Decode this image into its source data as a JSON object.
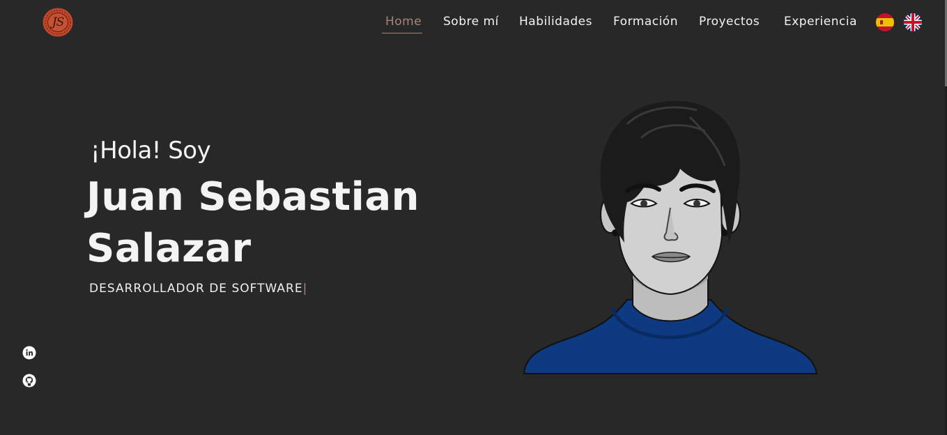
{
  "header": {
    "logo_monogram": "JS",
    "nav_items": [
      {
        "label": "Home",
        "active": true
      },
      {
        "label": "Sobre mí",
        "active": false
      },
      {
        "label": "Habilidades",
        "active": false
      },
      {
        "label": "Formación",
        "active": false
      },
      {
        "label": "Proyectos",
        "active": false
      },
      {
        "label": "Experiencia",
        "active": false
      }
    ],
    "languages": [
      {
        "icon": "spain-flag-icon"
      },
      {
        "icon": "uk-flag-icon"
      }
    ]
  },
  "hero": {
    "greeting": "¡Hola! Soy",
    "name_line1": "Juan Sebastian",
    "name_line2": "Salazar",
    "role": "DESARROLLADOR DE SOFTWARE",
    "cursor": "|"
  },
  "social": [
    {
      "icon": "linkedin-icon"
    },
    {
      "icon": "github-icon"
    }
  ],
  "colors": {
    "background": "#282828",
    "accent": "#a8857a",
    "text": "#f4f4f4",
    "logo": "#c2472a",
    "shirt": "#0e3a82"
  }
}
